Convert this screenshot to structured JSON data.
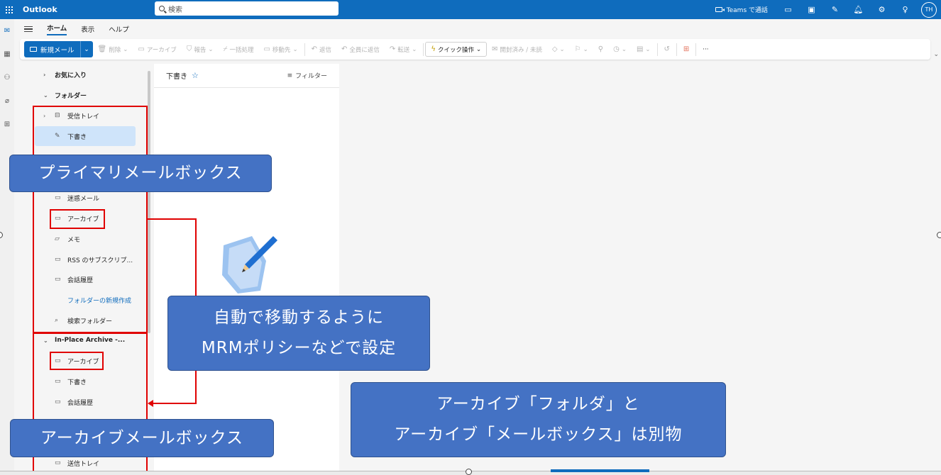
{
  "app": {
    "title": "Outlook"
  },
  "search": {
    "placeholder": "検索"
  },
  "topbar": {
    "teams_label": "Teams で通話",
    "avatar_initials": "TH"
  },
  "ribbon_tabs": [
    "ホーム",
    "表示",
    "ヘルプ"
  ],
  "ribbon": {
    "new_mail": "新規メール",
    "delete": "削除",
    "archive": "アーカイブ",
    "report": "報告",
    "sweep": "一括処理",
    "move_to": "移動先",
    "reply": "返信",
    "reply_all": "全員に返信",
    "forward": "転送",
    "quick_steps": "クイック操作",
    "read_unread": "開封済み / 未読",
    "more": "···"
  },
  "folders": {
    "favorites": "お気に入り",
    "folders_header": "フォルダー",
    "primary": [
      "受信トレイ",
      "下書き",
      "迷惑メール",
      "アーカイブ",
      "メモ",
      "RSS のサブスクリプ...",
      "会話履歴"
    ],
    "new_folder": "フォルダーの新規作成",
    "search_folders": "検索フォルダー",
    "archive_mailbox": "In-Place Archive -...",
    "archive_items": [
      "アーカイブ",
      "下書き",
      "会話履歴",
      "送信トレイ"
    ]
  },
  "message_list": {
    "title": "下書き",
    "filter": "フィルター"
  },
  "callouts": {
    "primary_mailbox": "プライマリメールボックス",
    "mrm_line1": "自動で移動するように",
    "mrm_line2": "MRMポリシーなどで設定",
    "archive_mailbox": "アーカイブメールボックス",
    "note_line1": "アーカイブ「フォルダ」と",
    "note_line2": "アーカイブ「メールボックス」は別物"
  }
}
